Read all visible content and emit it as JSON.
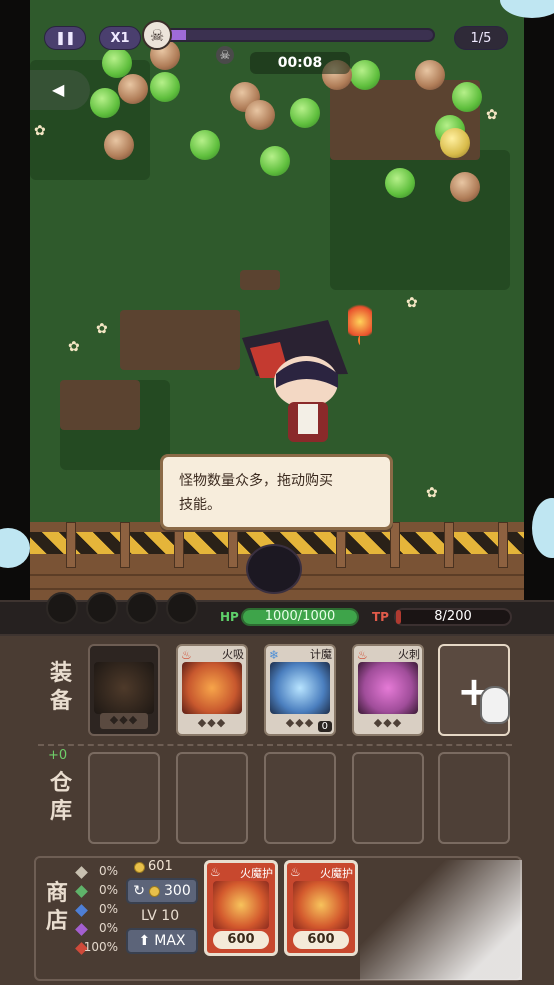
{
  "hud": {
    "pause_icon": "pause-icon",
    "speed_label": "X1",
    "wave_progress_fraction": 0.08,
    "wave_counter": "1/5",
    "timer": "00:08"
  },
  "tutorial": {
    "line1": "怪物数量众多，拖动购买",
    "line2": "技能。"
  },
  "status": {
    "hp_label": "HP",
    "hp_value": "1000/1000",
    "hp_fraction": 1.0,
    "tp_label": "TP",
    "tp_value": "8/200",
    "tp_fraction": 0.04
  },
  "equipment": {
    "label": "装备",
    "cards": [
      {
        "name": "",
        "stars": "◆◆◆",
        "art_color": "#3a2a22"
      },
      {
        "name": "火吸",
        "stars": "◆◆◆",
        "art_color": "#c8582e"
      },
      {
        "name": "计魔",
        "stars": "◆◆◆",
        "art_color": "#4b7fbf",
        "count": "0"
      },
      {
        "name": "火刺",
        "stars": "◆◆◆",
        "art_color": "#a04d9a"
      }
    ],
    "add_label": "+"
  },
  "warehouse": {
    "bonus": "+0",
    "label": "仓库"
  },
  "shop": {
    "label": "商店",
    "rarity_odds": [
      {
        "pct": "0%",
        "color": "#c8c0b0"
      },
      {
        "pct": "0%",
        "color": "#5fb36a"
      },
      {
        "pct": "0%",
        "color": "#4e7fd6"
      },
      {
        "pct": "0%",
        "color": "#a45fd0"
      },
      {
        "pct": "100%",
        "color": "#d04a3a"
      }
    ],
    "gold": "601",
    "refresh_cost": "300",
    "level": "LV 10",
    "upgrade_label": "MAX",
    "items": [
      {
        "name": "火魔护",
        "price": "600"
      },
      {
        "name": "火魔护",
        "price": "600"
      }
    ]
  },
  "colors": {
    "hp": "#3ea44a",
    "tp": "#e05b4a",
    "progress": "#9f6bd8"
  }
}
